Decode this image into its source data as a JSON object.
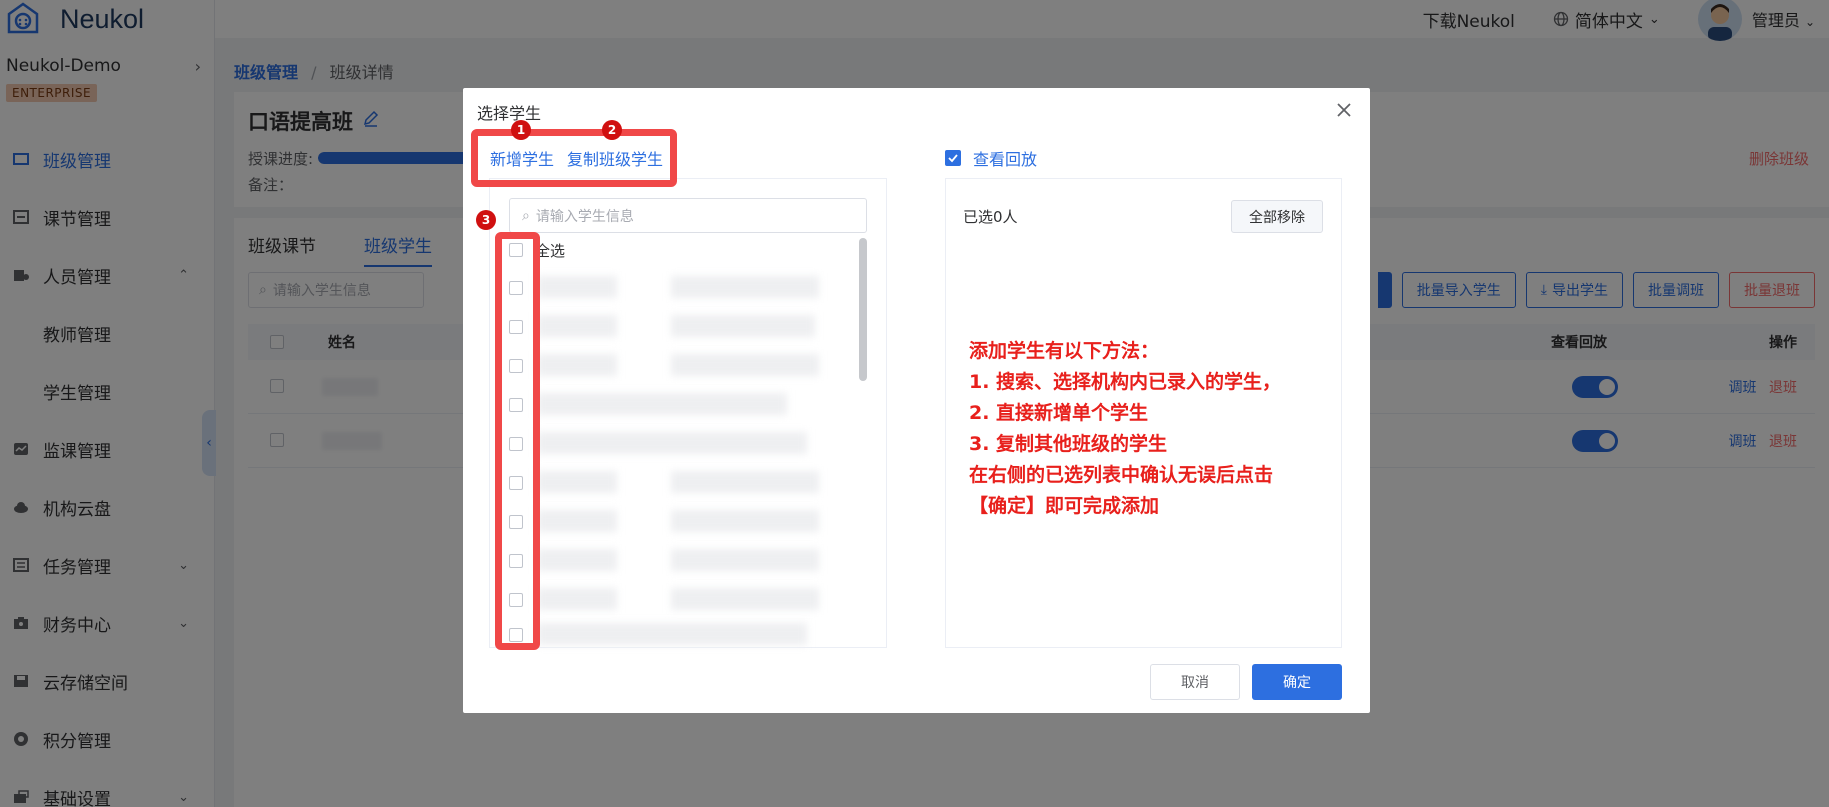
{
  "app": {
    "logo_text": "Neukol",
    "org_name": "Neukol-Demo",
    "edition_badge": "ENTERPRISE"
  },
  "topbar": {
    "download_link": "下载Neukol",
    "language": "简体中文",
    "user_name": "管理员"
  },
  "sidebar": {
    "items": [
      {
        "label": "班级管理",
        "icon": "class-icon"
      },
      {
        "label": "课节管理",
        "icon": "lesson-icon"
      },
      {
        "label": "人员管理",
        "icon": "people-icon"
      },
      {
        "label": "教师管理"
      },
      {
        "label": "学生管理"
      },
      {
        "label": "监课管理",
        "icon": "monitor-icon"
      },
      {
        "label": "机构云盘",
        "icon": "cloud-icon"
      },
      {
        "label": "任务管理",
        "icon": "task-icon"
      },
      {
        "label": "财务中心",
        "icon": "finance-icon"
      },
      {
        "label": "云存储空间",
        "icon": "storage-icon"
      },
      {
        "label": "积分管理",
        "icon": "points-icon"
      },
      {
        "label": "基础设置",
        "icon": "settings-icon"
      }
    ]
  },
  "breadcrumb": {
    "parent": "班级管理",
    "separator": "/",
    "current": "班级详情"
  },
  "class_info": {
    "title": "口语提高班",
    "progress_label": "授课进度:",
    "remark_label": "备注：",
    "delete_label": "删除班级"
  },
  "student_tab": {
    "tabs": [
      "班级课节",
      "班级学生"
    ],
    "search_placeholder": "请输入学生信息",
    "buttons": [
      "批量导入学生",
      "导出学生",
      "批量调班",
      "批量退班"
    ],
    "columns": {
      "name": "姓名",
      "replay": "查看回放",
      "op": "操作"
    },
    "row_actions": {
      "transfer": "调班",
      "withdraw": "退班"
    }
  },
  "dialog": {
    "title": "选择学生",
    "add_student": "新增学生",
    "copy_students": "复制班级学生",
    "replay_label": "查看回放",
    "search_placeholder": "请输入学生信息",
    "select_all": "全选",
    "selected_count": "已选0人",
    "remove_all": "全部移除",
    "tips": [
      "添加学生有以下方法：",
      "1. 搜索、选择机构内已录入的学生，",
      "2. 直接新增单个学生",
      "3. 复制其他班级的学生",
      "在右侧的已选列表中确认无误后点击",
      "【确定】即可完成添加"
    ],
    "cancel": "取消",
    "confirm": "确定",
    "markers": [
      "1",
      "2",
      "3"
    ]
  },
  "colors": {
    "primary": "#2d6fe0",
    "danger": "#f56c6c",
    "annotation": "#f04848",
    "tips_text": "#e8201c"
  }
}
